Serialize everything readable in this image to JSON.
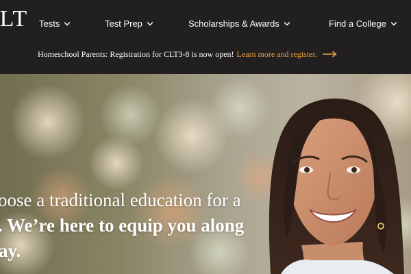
{
  "header": {
    "logo_text": "CLT",
    "nav": [
      {
        "label": "Tests",
        "icon": "chevron-down-icon"
      },
      {
        "label": "Test Prep",
        "icon": "chevron-down-icon"
      },
      {
        "label": "Scholarships & Awards",
        "icon": "chevron-down-icon"
      },
      {
        "label": "Find a College",
        "icon": "chevron-down-icon"
      }
    ],
    "announcement": {
      "text": "Homeschool Parents: Registration for CLT3-8 is now open!",
      "link": "Learn more and register.",
      "icon": "arrow-right-icon"
    }
  },
  "hero": {
    "line1": "oose a traditional education for a",
    "line2": ". We’re here to equip you along",
    "line3": "ay.",
    "image": "smiling-young-woman-photo"
  },
  "colors": {
    "nav_bg": "#221f20",
    "accent": "#e8a23d",
    "text": "#ffffff"
  }
}
